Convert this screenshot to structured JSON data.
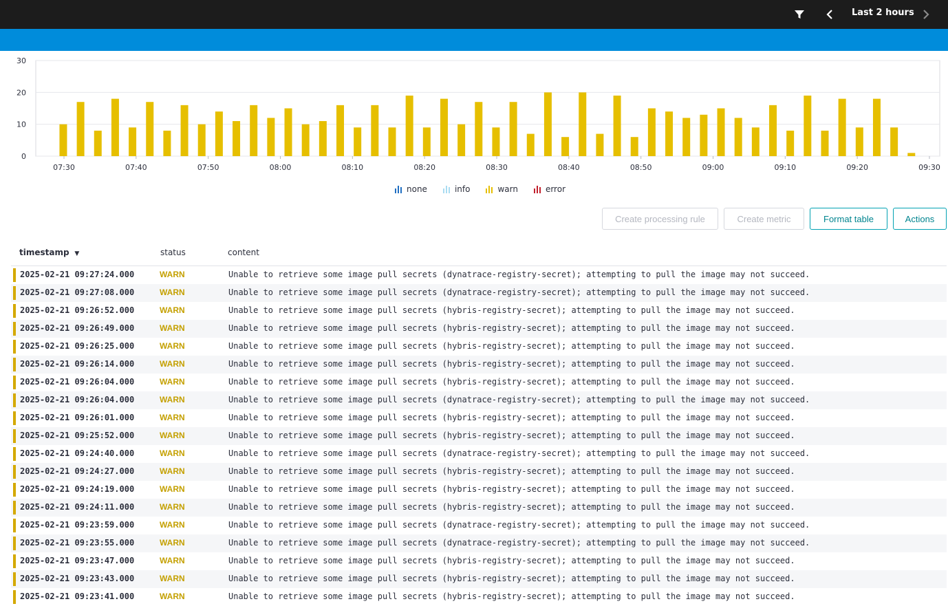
{
  "topbar": {
    "time_range": "Last 2 hours",
    "icons": [
      "filter-icon",
      "chevron-left-icon",
      "chevron-right-icon"
    ]
  },
  "colors": {
    "warn": "#e6bf00",
    "none": "#1f6ec2",
    "info": "#a9dcf2",
    "error": "#c21f2c",
    "header_bg": "#1c1c1c",
    "accent_bar": "#008cdb"
  },
  "chart_data": {
    "type": "bar",
    "y_ticks": [
      "0",
      "10",
      "20",
      "30"
    ],
    "ylim": [
      0,
      30
    ],
    "x_ticks": [
      "07:30",
      "07:40",
      "07:50",
      "08:00",
      "08:10",
      "08:20",
      "08:30",
      "08:40",
      "08:50",
      "09:00",
      "09:10",
      "09:20",
      "09:30"
    ],
    "bin_minutes": 2.4,
    "series": [
      {
        "name": "warn",
        "values": [
          10,
          17,
          8,
          18,
          9,
          17,
          8,
          16,
          10,
          14,
          11,
          16,
          12,
          15,
          10,
          11,
          16,
          9,
          16,
          9,
          19,
          9,
          18,
          10,
          17,
          9,
          17,
          7,
          20,
          6,
          20,
          7,
          19,
          6,
          15,
          14,
          12,
          13,
          15,
          12,
          9,
          16,
          8,
          19,
          8,
          18,
          9,
          18,
          9,
          1
        ]
      }
    ]
  },
  "legend": [
    {
      "label": "none",
      "color": "#1f6ec2"
    },
    {
      "label": "info",
      "color": "#a9dcf2"
    },
    {
      "label": "warn",
      "color": "#e6bf00"
    },
    {
      "label": "error",
      "color": "#c21f2c"
    }
  ],
  "actions": {
    "create_processing_rule": "Create processing rule",
    "create_metric": "Create metric",
    "format_table": "Format table",
    "actions": "Actions"
  },
  "table": {
    "headers": {
      "timestamp": "timestamp",
      "status": "status",
      "content": "content"
    },
    "rows": [
      [
        "2025-02-21 09:27:24.000",
        "WARN",
        "Unable to retrieve some image pull secrets (dynatrace-registry-secret); attempting to pull the image may not succeed."
      ],
      [
        "2025-02-21 09:27:08.000",
        "WARN",
        "Unable to retrieve some image pull secrets (dynatrace-registry-secret); attempting to pull the image may not succeed."
      ],
      [
        "2025-02-21 09:26:52.000",
        "WARN",
        "Unable to retrieve some image pull secrets (hybris-registry-secret); attempting to pull the image may not succeed."
      ],
      [
        "2025-02-21 09:26:49.000",
        "WARN",
        "Unable to retrieve some image pull secrets (hybris-registry-secret); attempting to pull the image may not succeed."
      ],
      [
        "2025-02-21 09:26:25.000",
        "WARN",
        "Unable to retrieve some image pull secrets (hybris-registry-secret); attempting to pull the image may not succeed."
      ],
      [
        "2025-02-21 09:26:14.000",
        "WARN",
        "Unable to retrieve some image pull secrets (hybris-registry-secret); attempting to pull the image may not succeed."
      ],
      [
        "2025-02-21 09:26:04.000",
        "WARN",
        "Unable to retrieve some image pull secrets (hybris-registry-secret); attempting to pull the image may not succeed."
      ],
      [
        "2025-02-21 09:26:04.000",
        "WARN",
        "Unable to retrieve some image pull secrets (dynatrace-registry-secret); attempting to pull the image may not succeed."
      ],
      [
        "2025-02-21 09:26:01.000",
        "WARN",
        "Unable to retrieve some image pull secrets (hybris-registry-secret); attempting to pull the image may not succeed."
      ],
      [
        "2025-02-21 09:25:52.000",
        "WARN",
        "Unable to retrieve some image pull secrets (hybris-registry-secret); attempting to pull the image may not succeed."
      ],
      [
        "2025-02-21 09:24:40.000",
        "WARN",
        "Unable to retrieve some image pull secrets (dynatrace-registry-secret); attempting to pull the image may not succeed."
      ],
      [
        "2025-02-21 09:24:27.000",
        "WARN",
        "Unable to retrieve some image pull secrets (hybris-registry-secret); attempting to pull the image may not succeed."
      ],
      [
        "2025-02-21 09:24:19.000",
        "WARN",
        "Unable to retrieve some image pull secrets (hybris-registry-secret); attempting to pull the image may not succeed."
      ],
      [
        "2025-02-21 09:24:11.000",
        "WARN",
        "Unable to retrieve some image pull secrets (hybris-registry-secret); attempting to pull the image may not succeed."
      ],
      [
        "2025-02-21 09:23:59.000",
        "WARN",
        "Unable to retrieve some image pull secrets (dynatrace-registry-secret); attempting to pull the image may not succeed."
      ],
      [
        "2025-02-21 09:23:55.000",
        "WARN",
        "Unable to retrieve some image pull secrets (dynatrace-registry-secret); attempting to pull the image may not succeed."
      ],
      [
        "2025-02-21 09:23:47.000",
        "WARN",
        "Unable to retrieve some image pull secrets (hybris-registry-secret); attempting to pull the image may not succeed."
      ],
      [
        "2025-02-21 09:23:43.000",
        "WARN",
        "Unable to retrieve some image pull secrets (hybris-registry-secret); attempting to pull the image may not succeed."
      ],
      [
        "2025-02-21 09:23:41.000",
        "WARN",
        "Unable to retrieve some image pull secrets (hybris-registry-secret); attempting to pull the image may not succeed."
      ]
    ]
  }
}
